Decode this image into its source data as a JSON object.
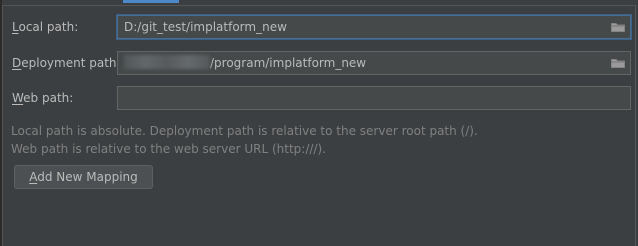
{
  "form": {
    "local_path": {
      "label_mnemonic": "L",
      "label_rest": "ocal path:",
      "value": "D:/git_test/implatform_new"
    },
    "deployment_path": {
      "label_mnemonic": "D",
      "label_rest": "eployment path:",
      "value": "/program/implatform_new"
    },
    "web_path": {
      "label_mnemonic": "W",
      "label_rest": "eb path:",
      "value": ""
    }
  },
  "hints": {
    "line1": "Local path is absolute. Deployment path is relative to the server root path (/).",
    "line2": "Web path is relative to the web server URL (http:///)."
  },
  "actions": {
    "add_mapping_mnemonic": "A",
    "add_mapping_rest": "dd New Mapping"
  },
  "icons": {
    "browse": "folder-icon"
  },
  "colors": {
    "background": "#3c3f41",
    "field_background": "#45494a",
    "focus_border": "#466d94",
    "tab_indicator": "#4a88c7"
  }
}
